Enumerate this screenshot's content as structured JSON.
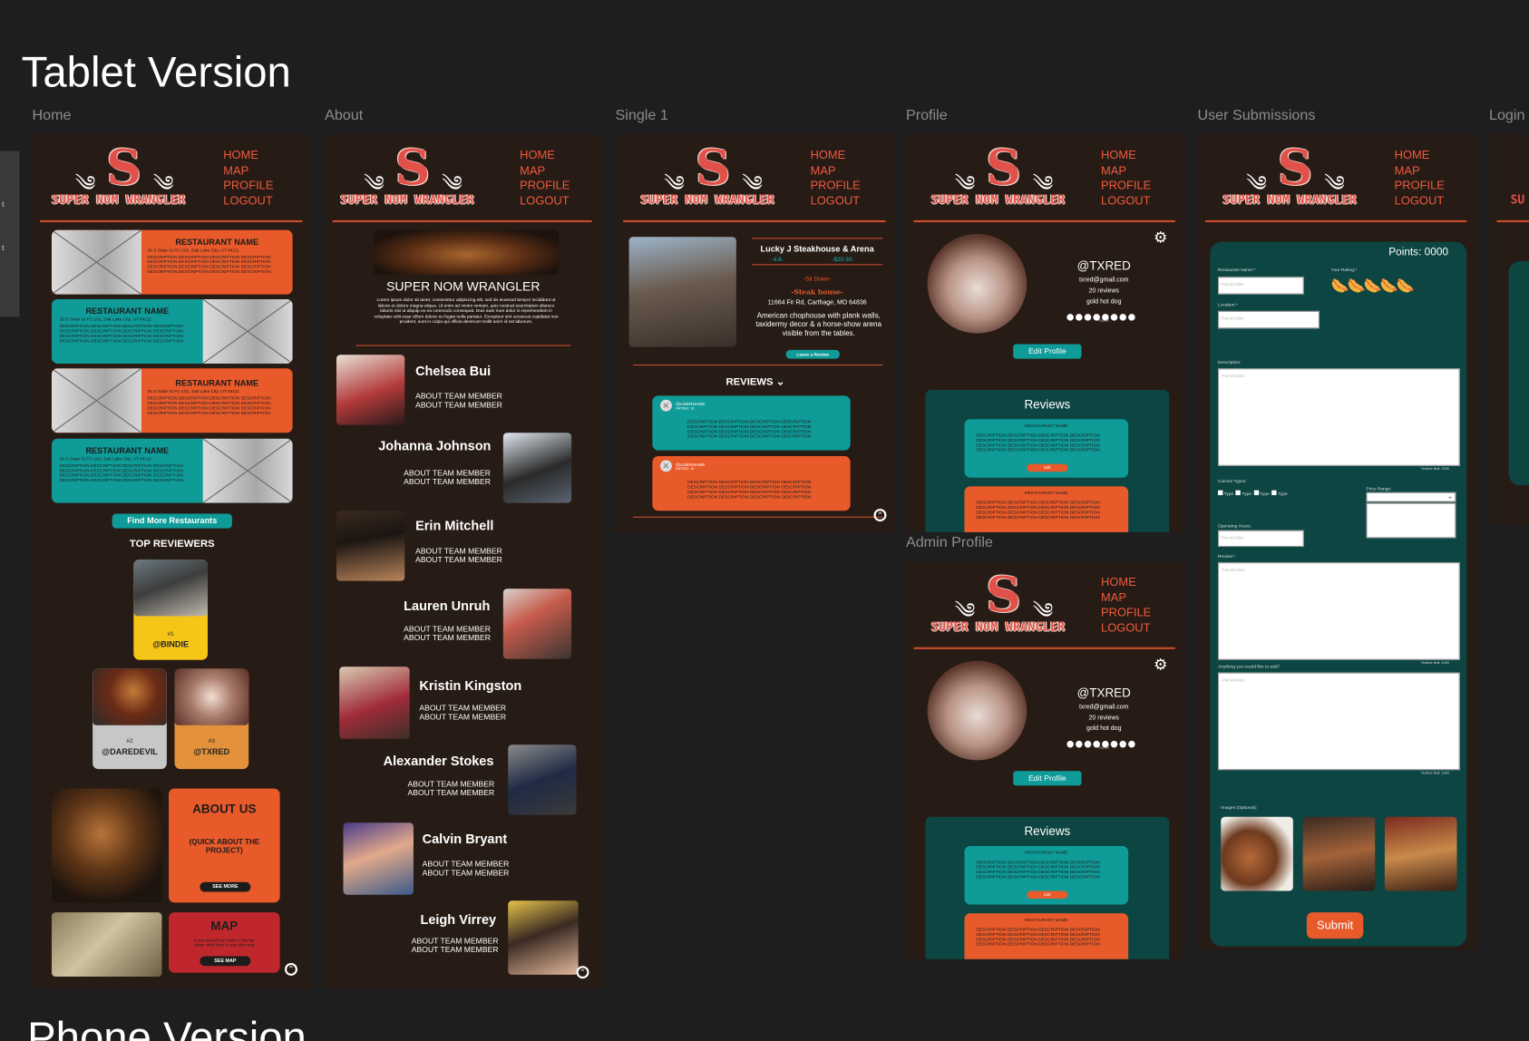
{
  "page": {
    "tablet_heading": "Tablet Version",
    "phone_heading": "Phone Version"
  },
  "frames": {
    "home": "Home",
    "about": "About",
    "single": "Single 1",
    "profile": "Profile",
    "admin_profile": "Admin Profile",
    "user_submissions": "User Submissions",
    "login": "Login"
  },
  "brand": {
    "logo_letter": "S",
    "logo_text": "SUPER NOM WRANGLER"
  },
  "nav": [
    "HOME",
    "MAP",
    "PROFILE",
    "LOGOUT"
  ],
  "home": {
    "restaurant_name": "RESTAURANT NAME",
    "address": "28 S State St FC-101, Salt Lake City, UT 84111",
    "description": "DESCRIPTION DESCRIPTION DESCRIPTION DESCRIPTION DESCRIPTION DESCRIPTION DESCRIPTION DESCRIPTION DESCRIPTION DESCRIPTION DESCRIPTION DESCRIPTION DESCRIPTION DESCRIPTION DESCRIPTION DESCRIPTION",
    "find_more": "Find More Restaurants",
    "top_reviewers": "TOP REVIEWERS",
    "reviewers": [
      {
        "rank": "#1",
        "handle": "@BINDIE"
      },
      {
        "rank": "#2",
        "handle": "@DAREDEVIL"
      },
      {
        "rank": "#3",
        "handle": "@TXRED"
      }
    ],
    "about_us": "ABOUT US",
    "about_us_sub": "(QUICK ABOUT THE PROJECT)",
    "see_more": "SEE MORE",
    "map": "MAP",
    "map_sub": "if you somehow made it this far down click here to see the map",
    "see_map": "SEE MAP"
  },
  "about": {
    "title": "SUPER NOM WRANGLER",
    "lorem": "Lorem ipsum dolor sit amet, consectetur adipiscing elit, sed do eiusmod tempor incididunt ut labore et dolore magna aliqua. Ut enim ad minim veniam, quis nostrud exercitation ullamco laboris nisi ut aliquip ex ea commodo consequat. Duis aute irure dolor in reprehenderit in voluptate velit esse cillum dolore eu fugiat nulla pariatur. Excepteur sint occaecat cupidatat non proident, sunt in culpa qui officia deserunt mollit anim id est laborum.",
    "role": "ABOUT TEAM MEMBER",
    "members": [
      "Chelsea Bui",
      "Johanna Johnson",
      "Erin Mitchell",
      "Lauren Unruh",
      "Kristin Kingston",
      "Alexander Stokes",
      "Calvin Bryant",
      "Leigh Virrey"
    ]
  },
  "single": {
    "name": "Lucky J Steakhouse & Arena",
    "rating": "-4.6-",
    "price": "-$20-30-",
    "type1": "-Sit Down-",
    "type2": "-Steak house-",
    "address": "11664 Fir Rd, Carthage, MO 64836",
    "blurb": "American chophouse with plank walls, taxidermy decor & a horse-show arena visible from the tables.",
    "leave_review": "Leave a Review",
    "reviews": "REVIEWS",
    "username": "@USERNAME",
    "rating_small": "RATING: 10",
    "desc": "DESCRIPTION DESCRIPTION DESCRIPTION DESCRIPTION DESCRIPTION DESCRIPTION DESCRIPTION DESCRIPTION DESCRIPTION DESCRIPTION DESCRIPTION DESCRIPTION DESCRIPTION DESCRIPTION DESCRIPTION DESCRIPTION"
  },
  "profile": {
    "handle": "@TXRED",
    "email": "txred@gmail.com",
    "reviews_count": "20 reviews",
    "rank": "gold hot dog",
    "trophies": "trophies",
    "edit": "Edit Profile",
    "reviews_title": "Reviews",
    "restaurant_name": "RESTAURANT NAME",
    "edit_small": "Edit",
    "desc": "DESCRIPTION DESCRIPTION DESCRIPTION DESCRIPTION DESCRIPTION DESCRIPTION DESCRIPTION DESCRIPTION DESCRIPTION DESCRIPTION DESCRIPTION DESCRIPTION DESCRIPTION DESCRIPTION DESCRIPTION DESCRIPTION"
  },
  "submit": {
    "points": "Points: 0000",
    "restaurant_name": "Restaurant Name:*",
    "your_rating": "Your Rating:*",
    "location": "Location:*",
    "description": "Description:",
    "placeholder": "Placeholder",
    "cuisine_types": "Cuisine Types:",
    "type": "Type",
    "price_range": "Price Range:",
    "hours": "Operating Hours:",
    "review": "Review:*",
    "anything": "Anything you would like to add?",
    "limit": "Textbox limit: 1000",
    "images": "Images (Optional):",
    "submit": "Submit"
  },
  "colors": {
    "bg": "#1e1e1e",
    "frame": "#271b16",
    "orange": "#e85a2a",
    "teal": "#0f9b98",
    "dark_teal": "#0d4543",
    "nav": "#ef5a3c"
  }
}
